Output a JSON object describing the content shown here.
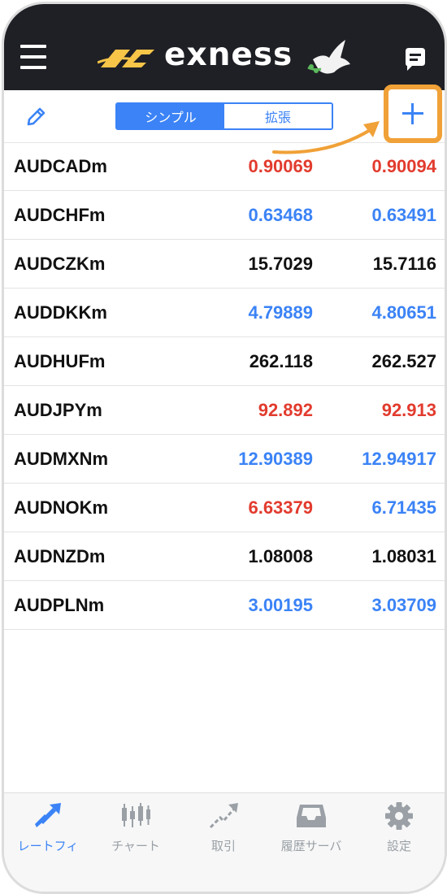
{
  "header": {
    "brand": "exness",
    "colors": {
      "background": "#1f2025",
      "logo_accent": "#f7c548"
    }
  },
  "toolbar": {
    "segments": [
      {
        "label": "シンプル",
        "active": true
      },
      {
        "label": "拡張",
        "active": false
      }
    ],
    "colors": {
      "accent": "#3b83f6",
      "highlight": "#f0a137"
    }
  },
  "quotes": [
    {
      "symbol": "AUDCADm",
      "bid": "0.90069",
      "ask": "0.90094",
      "bid_color": "#e23b2e",
      "ask_color": "#e23b2e"
    },
    {
      "symbol": "AUDCHFm",
      "bid": "0.63468",
      "ask": "0.63491",
      "bid_color": "#3b83f6",
      "ask_color": "#3b83f6"
    },
    {
      "symbol": "AUDCZKm",
      "bid": "15.7029",
      "ask": "15.7116",
      "bid_color": "#111111",
      "ask_color": "#111111"
    },
    {
      "symbol": "AUDDKKm",
      "bid": "4.79889",
      "ask": "4.80651",
      "bid_color": "#3b83f6",
      "ask_color": "#3b83f6"
    },
    {
      "symbol": "AUDHUFm",
      "bid": "262.118",
      "ask": "262.527",
      "bid_color": "#111111",
      "ask_color": "#111111"
    },
    {
      "symbol": "AUDJPYm",
      "bid": "92.892",
      "ask": "92.913",
      "bid_color": "#e23b2e",
      "ask_color": "#e23b2e"
    },
    {
      "symbol": "AUDMXNm",
      "bid": "12.90389",
      "ask": "12.94917",
      "bid_color": "#3b83f6",
      "ask_color": "#3b83f6"
    },
    {
      "symbol": "AUDNOKm",
      "bid": "6.63379",
      "ask": "6.71435",
      "bid_color": "#e23b2e",
      "ask_color": "#3b83f6"
    },
    {
      "symbol": "AUDNZDm",
      "bid": "1.08008",
      "ask": "1.08031",
      "bid_color": "#111111",
      "ask_color": "#111111"
    },
    {
      "symbol": "AUDPLNm",
      "bid": "3.00195",
      "ask": "3.03709",
      "bid_color": "#3b83f6",
      "ask_color": "#3b83f6"
    }
  ],
  "tabs": [
    {
      "label": "レートフィ",
      "icon": "quotes-icon",
      "active": true
    },
    {
      "label": "チャート",
      "icon": "candlestick-chart-icon",
      "active": false
    },
    {
      "label": "取引",
      "icon": "trade-icon",
      "active": false
    },
    {
      "label": "履歴サーバ",
      "icon": "inbox-icon",
      "active": false
    },
    {
      "label": "設定",
      "icon": "gear-icon",
      "active": false
    }
  ]
}
